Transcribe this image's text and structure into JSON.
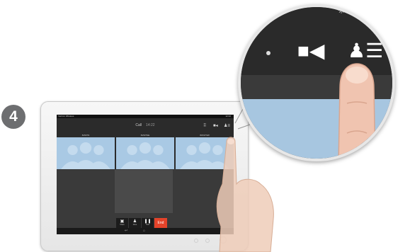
{
  "step": {
    "number": "4"
  },
  "tablet": {
    "status": {
      "carrier": "Verizon Wireless",
      "time": "12:22"
    },
    "call": {
      "title": "Call",
      "duration": "14:22"
    },
    "tiles": [
      {
        "name": "81537N"
      },
      {
        "name": "81537NE"
      },
      {
        "name": "81537NW"
      }
    ],
    "controls": [
      {
        "icon": "share-icon",
        "label": "Share"
      },
      {
        "icon": "participant-icon",
        "label": "Mute"
      },
      {
        "icon": "pause-icon",
        "label": "Hold"
      },
      {
        "icon": "end-icon",
        "label": "End"
      }
    ]
  },
  "zoom": {
    "icons": [
      "video-camera-icon",
      "participants-list-icon"
    ]
  },
  "colors": {
    "end_button": "#e4432a",
    "screen_dark": "#2b2b2b",
    "tile_blue": "#a9c9e4",
    "step_badge": "#6d6e70"
  }
}
